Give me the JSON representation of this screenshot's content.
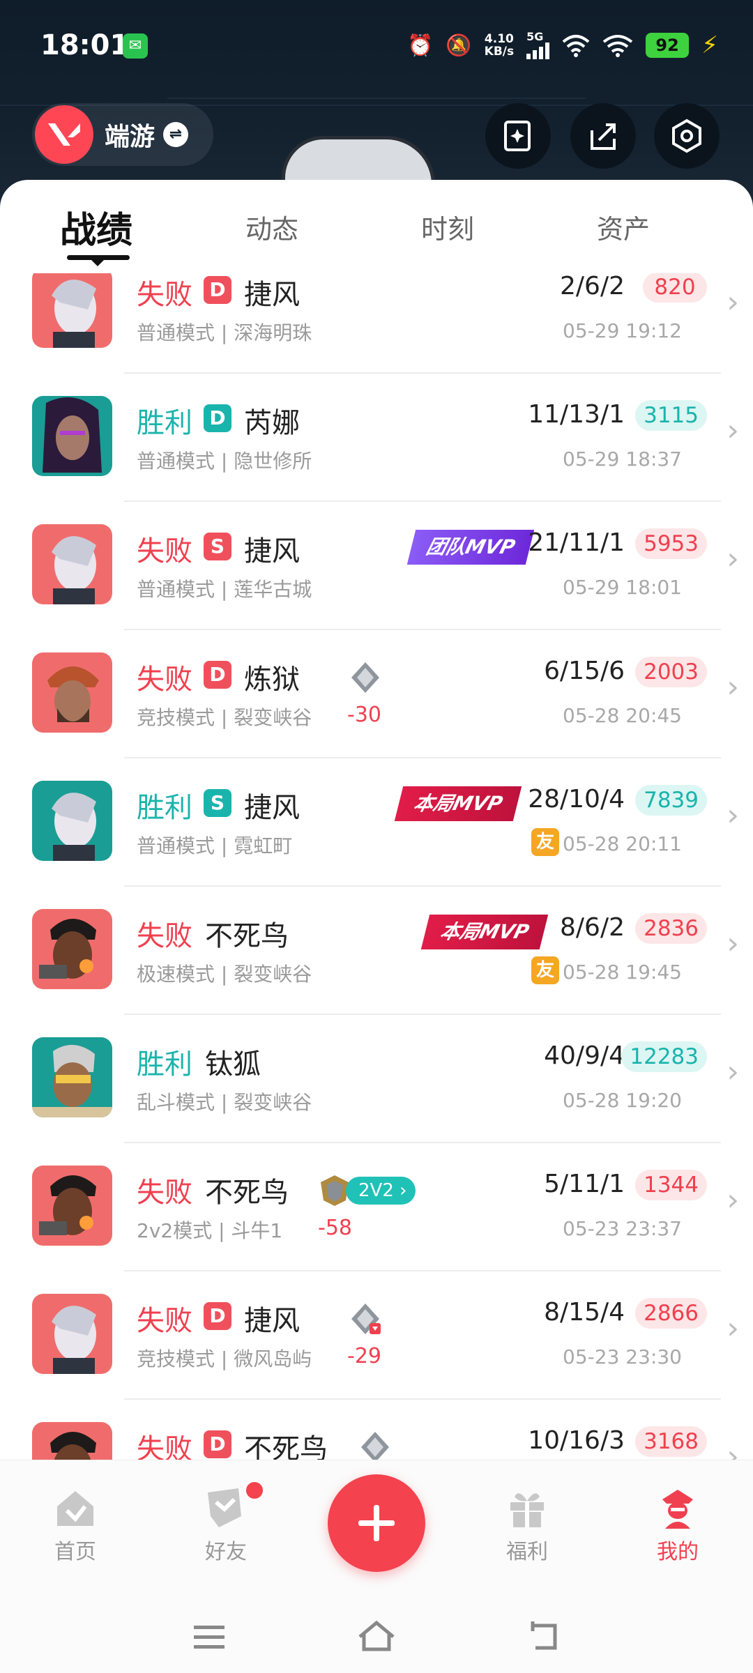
{
  "status_bar": {
    "time": "18:01",
    "net_speed_value": "4.10",
    "net_speed_unit": "KB/s",
    "network": "5G",
    "battery": "92"
  },
  "header": {
    "game_name": "端游"
  },
  "tabs": [
    {
      "label": "战绩",
      "active": true
    },
    {
      "label": "动态",
      "active": false
    },
    {
      "label": "时刻",
      "active": false
    },
    {
      "label": "资产",
      "active": false
    }
  ],
  "matches": [
    {
      "result": "失败",
      "outcome": "loss",
      "tag": "D",
      "agent": "捷风",
      "mode": "普通模式 | 深海明珠",
      "kda": "2/6/2",
      "score": "820",
      "date": "05-29 19:12"
    },
    {
      "result": "胜利",
      "outcome": "win",
      "tag": "D",
      "agent": "芮娜",
      "mode": "普通模式 | 隐世修所",
      "kda": "11/13/1",
      "score": "3115",
      "date": "05-29 18:37"
    },
    {
      "result": "失败",
      "outcome": "loss",
      "tag": "S",
      "agent": "捷风",
      "mode": "普通模式 | 莲华古城",
      "kda": "21/11/1",
      "score": "5953",
      "date": "05-29 18:01",
      "mvp": "团队MVP"
    },
    {
      "result": "失败",
      "outcome": "loss",
      "tag": "D",
      "agent": "炼狱",
      "mode": "竞技模式 | 裂变峡谷",
      "kda": "6/15/6",
      "score": "2003",
      "date": "05-28 20:45",
      "rank_delta": "-30"
    },
    {
      "result": "胜利",
      "outcome": "win",
      "tag": "S",
      "agent": "捷风",
      "mode": "普通模式 | 霓虹町",
      "kda": "28/10/4",
      "score": "7839",
      "date": "05-28 20:11",
      "mvp": "本局MVP",
      "friend": "友"
    },
    {
      "result": "失败",
      "outcome": "loss",
      "agent": "不死鸟",
      "mode": "极速模式 | 裂变峡谷",
      "kda": "8/6/2",
      "score": "2836",
      "date": "05-28 19:45",
      "mvp": "本局MVP",
      "friend": "友"
    },
    {
      "result": "胜利",
      "outcome": "win",
      "agent": "钛狐",
      "mode": "乱斗模式 | 裂变峡谷",
      "kda": "40/9/4",
      "score": "12283",
      "date": "05-28 19:20"
    },
    {
      "result": "失败",
      "outcome": "loss",
      "agent": "不死鸟",
      "mode": "2v2模式 | 斗牛1",
      "kda": "5/11/1",
      "score": "1344",
      "date": "05-23 23:37",
      "rank_delta": "-58",
      "badge": "2V2"
    },
    {
      "result": "失败",
      "outcome": "loss",
      "tag": "D",
      "agent": "捷风",
      "mode": "竞技模式 | 微风岛屿",
      "kda": "8/15/4",
      "score": "2866",
      "date": "05-23 23:30",
      "rank_delta": "-29"
    },
    {
      "result": "失败",
      "outcome": "loss",
      "tag": "D",
      "agent": "不死鸟",
      "mode": "",
      "kda": "10/16/3",
      "score": "3168",
      "date": ""
    }
  ],
  "bottom_nav": [
    {
      "label": "首页",
      "icon": "home-icon"
    },
    {
      "label": "好友",
      "icon": "friends-icon"
    },
    {
      "label": "福利",
      "icon": "gift-icon"
    },
    {
      "label": "我的",
      "icon": "profile-icon"
    }
  ],
  "colors": {
    "loss": "#f0404f",
    "win": "#19b4ac",
    "accent": "#f4424e",
    "header_bg": "#13212f"
  }
}
